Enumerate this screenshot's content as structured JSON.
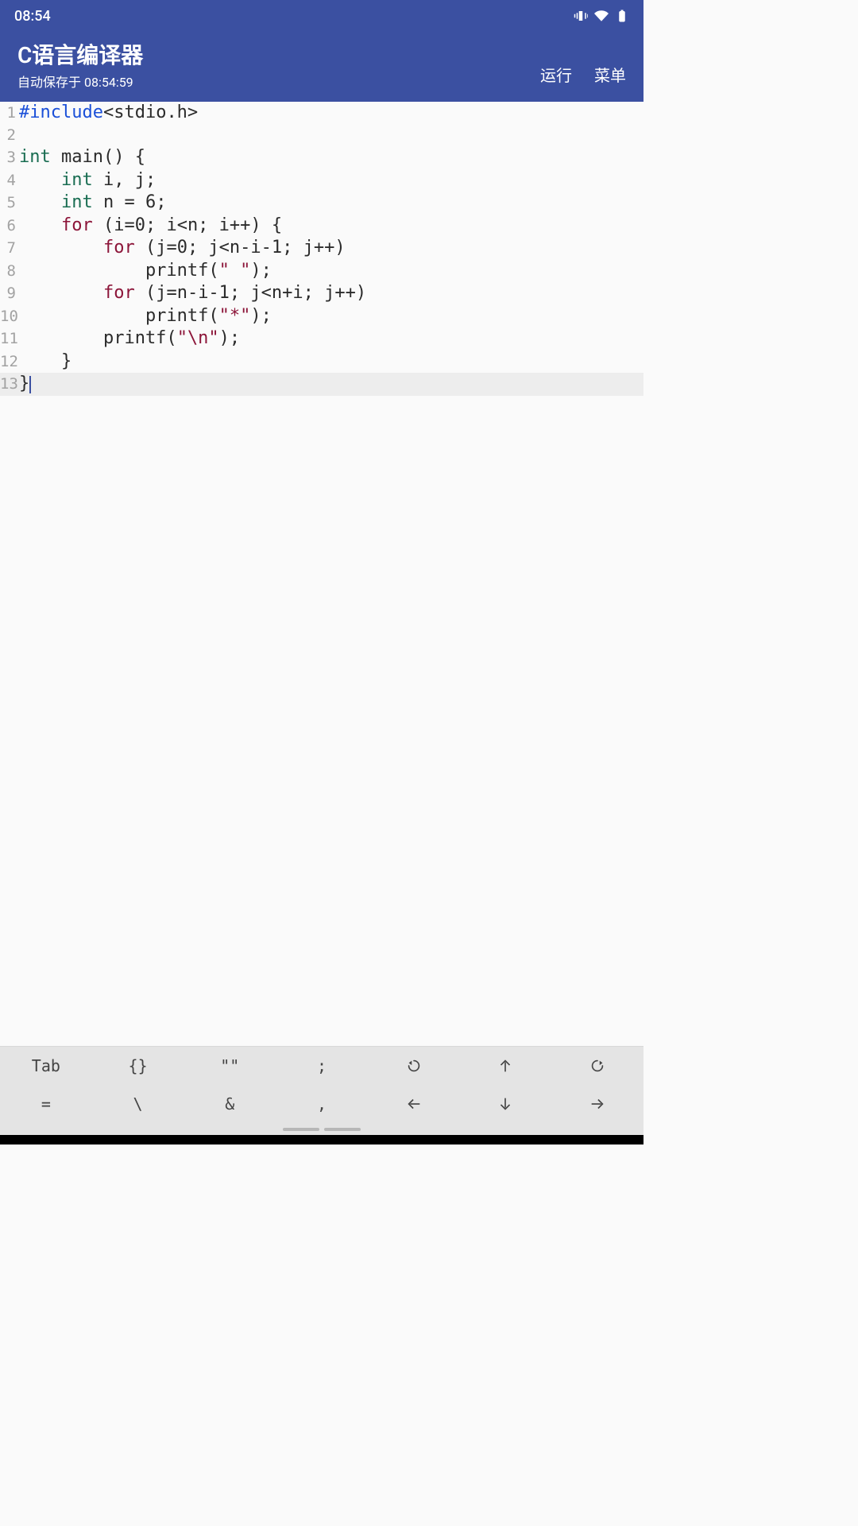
{
  "status": {
    "time": "08:54"
  },
  "header": {
    "title": "C语言编译器",
    "subtitle": "自动保存于 08:54:59",
    "run_label": "运行",
    "menu_label": "菜单"
  },
  "editor": {
    "current_line": 13,
    "lines": [
      {
        "n": 1,
        "tokens": [
          [
            "pp",
            "#include"
          ],
          [
            "plain",
            "<stdio.h>"
          ]
        ]
      },
      {
        "n": 2,
        "tokens": []
      },
      {
        "n": 3,
        "tokens": [
          [
            "kw",
            "int"
          ],
          [
            "plain",
            " main() {"
          ]
        ]
      },
      {
        "n": 4,
        "tokens": [
          [
            "plain",
            "    "
          ],
          [
            "kw",
            "int"
          ],
          [
            "plain",
            " i, j;"
          ]
        ]
      },
      {
        "n": 5,
        "tokens": [
          [
            "plain",
            "    "
          ],
          [
            "kw",
            "int"
          ],
          [
            "plain",
            " n = 6;"
          ]
        ]
      },
      {
        "n": 6,
        "tokens": [
          [
            "plain",
            "    "
          ],
          [
            "ctrl",
            "for"
          ],
          [
            "plain",
            " (i=0; i<n; i++) {"
          ]
        ]
      },
      {
        "n": 7,
        "tokens": [
          [
            "plain",
            "        "
          ],
          [
            "ctrl",
            "for"
          ],
          [
            "plain",
            " (j=0; j<n-i-1; j++)"
          ]
        ]
      },
      {
        "n": 8,
        "tokens": [
          [
            "plain",
            "            printf("
          ],
          [
            "str",
            "\" \""
          ],
          [
            "plain",
            ");"
          ]
        ]
      },
      {
        "n": 9,
        "tokens": [
          [
            "plain",
            "        "
          ],
          [
            "ctrl",
            "for"
          ],
          [
            "plain",
            " (j=n-i-1; j<n+i; j++)"
          ]
        ]
      },
      {
        "n": 10,
        "tokens": [
          [
            "plain",
            "            printf("
          ],
          [
            "str",
            "\"*\""
          ],
          [
            "plain",
            ");"
          ]
        ]
      },
      {
        "n": 11,
        "tokens": [
          [
            "plain",
            "        printf("
          ],
          [
            "str",
            "\"\\n\""
          ],
          [
            "plain",
            ");"
          ]
        ]
      },
      {
        "n": 12,
        "tokens": [
          [
            "plain",
            "    }"
          ]
        ]
      },
      {
        "n": 13,
        "tokens": [
          [
            "plain",
            "}"
          ]
        ]
      }
    ]
  },
  "shortcuts": {
    "row1": [
      "Tab",
      "{}",
      "\"\"",
      ";",
      "undo-icon",
      "up-icon",
      "redo-icon"
    ],
    "row2": [
      "=",
      "\\",
      "&",
      ",",
      "left-icon",
      "down-icon",
      "right-icon"
    ]
  }
}
